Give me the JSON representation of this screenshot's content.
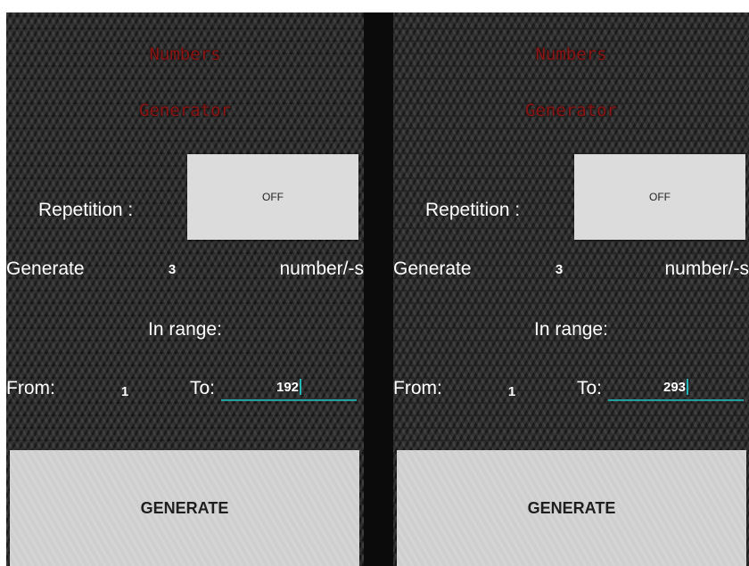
{
  "screens": [
    {
      "title_line1": "Numbers",
      "title_line2": "Generator",
      "repetition_label": "Repetition :",
      "repetition_toggle": "OFF",
      "generate_label": "Generate",
      "count_value": "3",
      "units_label": "number/-s",
      "range_label": "In range:",
      "from_label": "From:",
      "from_value": "1",
      "to_label": "To:",
      "to_value": "192",
      "generate_button": "GENERATE"
    },
    {
      "title_line1": "Numbers",
      "title_line2": "Generator",
      "repetition_label": "Repetition :",
      "repetition_toggle": "OFF",
      "generate_label": "Generate",
      "count_value": "3",
      "units_label": "number/-s",
      "range_label": "In range:",
      "from_label": "From:",
      "from_value": "1",
      "to_label": "To:",
      "to_value": "293",
      "generate_button": "GENERATE"
    }
  ],
  "colors": {
    "title": "#8a1515",
    "accent_underline": "#20a0a0",
    "button_bg": "#dcdcdc"
  }
}
